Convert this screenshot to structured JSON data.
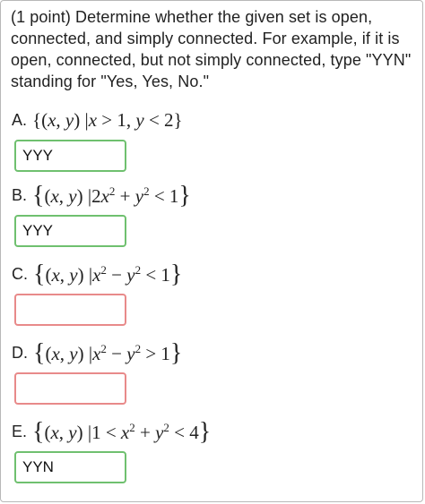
{
  "intro": "(1 point) Determine whether the given set is open, connected, and simply connected. For example, if it is open, connected, but not simply connected, type \"YYN\" standing for \"Yes, Yes, No.\"",
  "questions": [
    {
      "letter": "A.",
      "answer": "YYY",
      "state": "filled"
    },
    {
      "letter": "B.",
      "answer": "YYY",
      "state": "filled"
    },
    {
      "letter": "C.",
      "answer": "",
      "state": "empty"
    },
    {
      "letter": "D.",
      "answer": "",
      "state": "empty"
    },
    {
      "letter": "E.",
      "answer": "YYN",
      "state": "filled"
    }
  ],
  "colors": {
    "correct_border": "#6fc06f",
    "incorrect_border": "#e88a8a"
  }
}
